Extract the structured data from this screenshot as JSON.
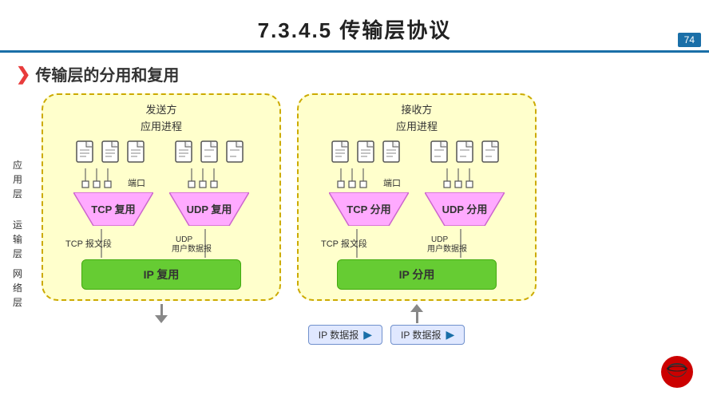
{
  "header": {
    "title": "7.3.4.5   传输层协议",
    "page_number": "74"
  },
  "section": {
    "title": "传输层的分用和复用",
    "arrow": "❯"
  },
  "layers": {
    "app": "应\n用\n层",
    "transport": "运\n输\n层",
    "network": "网\n络\n层"
  },
  "sender": {
    "title": "发送方",
    "subtitle": "应用进程",
    "port_label": "端口",
    "tcp_label": "TCP 复用",
    "udp_label": "UDP 复用",
    "tcp_segment": "TCP 报文段",
    "udp_segment": "UDP\n用户数据报",
    "ip_label": "IP 复用"
  },
  "receiver": {
    "title": "接收方",
    "subtitle": "应用进程",
    "port_label": "端口",
    "tcp_label": "TCP 分用",
    "udp_label": "UDP 分用",
    "tcp_segment": "TCP 报文段",
    "udp_segment": "UDP\n用户数据报",
    "ip_label": "IP 分用"
  },
  "ip_packet": {
    "label1": "IP 数据报",
    "label2": "IP 数据报",
    "arrow": "▶"
  },
  "colors": {
    "yellow_bg": "#ffffcc",
    "green_ip": "#66cc33",
    "pink_funnel": "#ffccff",
    "blue_accent": "#1a6fa8",
    "packet_bg": "#dde8ff"
  }
}
